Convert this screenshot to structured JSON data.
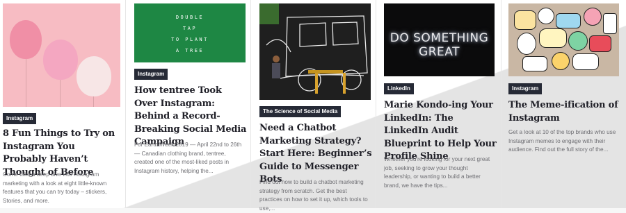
{
  "cards": [
    {
      "badge": "Instagram",
      "title": "8 Fun Things to Try on Instagram You Probably Haven’t Thought of Before",
      "excerpt": "Come take a deep dive into Instagram marketing with a look at eight little-known features that you can try today – stickers, Stories, and more.",
      "image_icon": "pink-balloons-image"
    },
    {
      "badge": "Instagram",
      "title": "How tentree Took Over Instagram: Behind a Record-Breaking Social Media Campaign",
      "excerpt": "For Earth Week 2019 — April 22nd to 26th — Canadian clothing brand, tentree, created one of the most-liked posts in Instagram history, helping the...",
      "image_icon": "double-tap-sign-image",
      "image_text": [
        "DOUBLE",
        "TAP",
        "TO PLANT",
        "A TREE"
      ]
    },
    {
      "badge": "The Science of Social Media",
      "title": "Need a Chatbot Marketing Strategy? Start Here: Beginner’s Guide to Messenger Bots",
      "excerpt": "Find out how to build a chatbot marketing strategy from scratch. Get the best practices on how to set it up, which tools to use,...",
      "image_icon": "chalk-mural-office-image"
    },
    {
      "badge": "LinkedIn",
      "title": "Marie Kondo-ing Your LinkedIn: The LinkedIn Audit Blueprint to Help Your Profile Shine",
      "excerpt": "Whether you're looking for your next great job, seeking to grow your thought leadership, or wanting to build a better brand, we have the tips...",
      "image_icon": "neon-sign-image",
      "image_text": "DO SOMETHING GREAT"
    },
    {
      "badge": "Instagram",
      "title": "The Meme-ification of Instagram",
      "excerpt": "Get a look at 10 of the top brands who use Instagram memes to engage with their audience. Find out the full story of the...",
      "image_icon": "sticker-laptop-image"
    }
  ]
}
